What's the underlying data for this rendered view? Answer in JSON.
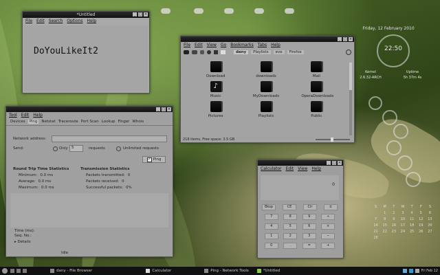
{
  "top_left_window": {
    "title": "*Untitled",
    "menu": [
      "File",
      "Edit",
      "Search",
      "Options",
      "Help"
    ],
    "content": "DoYouLikeIt2"
  },
  "file_browser": {
    "menu": [
      "File",
      "Edit",
      "View",
      "Go",
      "Bookmarks",
      "Tabs",
      "Help"
    ],
    "location_tabs": [
      "dany",
      "Playlists",
      "eve",
      "Firefox"
    ],
    "items": [
      "Download",
      "downloads",
      "Mail",
      "Music",
      "MyDownloads",
      "OperaDownloads",
      "Pictures",
      "Playlists",
      "Public"
    ],
    "status": "218 items, Free space: 3.5 GB"
  },
  "network_tools": {
    "menu": [
      "Tool",
      "Edit",
      "Help"
    ],
    "tabs": [
      "Devices",
      "Ping",
      "Netstat",
      "Traceroute",
      "Port Scan",
      "Lookup",
      "Finger",
      "Whois"
    ],
    "network_address_label": "Network address:",
    "send_label": "Send:",
    "only_label": "Only",
    "only_value": "5",
    "requests_label": "requests",
    "unlimited_label": "Unlimited requests",
    "ping_button": "Ping",
    "rtt_title": "Round Trip Time Statistics",
    "rtt": [
      {
        "label": "Minimum:",
        "value": "0.0 ms"
      },
      {
        "label": "Average:",
        "value": "0.0 ms"
      },
      {
        "label": "Maximum:",
        "value": "0.0 ms"
      }
    ],
    "trans_title": "Transmission Statistics",
    "trans": [
      {
        "label": "Packets transmitted:",
        "value": "0"
      },
      {
        "label": "Packets received:",
        "value": "0"
      },
      {
        "label": "Successful packets:",
        "value": "0%"
      }
    ],
    "time_label": "Time (ms):",
    "seq_label": "Seq. No.:",
    "details": "Details",
    "status": "Idle"
  },
  "calculator": {
    "menu": [
      "Calculator",
      "Edit",
      "View",
      "Help"
    ],
    "display": "0",
    "fn_buttons": [
      "Bksp",
      "CE",
      "Clr",
      "±"
    ],
    "keys": [
      "7",
      "8",
      "9",
      "÷",
      "4",
      "5",
      "6",
      "×",
      "1",
      "2",
      "3",
      "−",
      "0",
      ".",
      "=",
      "+"
    ]
  },
  "desktop_widgets": {
    "date": "Friday, 12 February 2010",
    "time": "22:50",
    "kernel_label": "Kernel",
    "kernel": "2.6.32-ARCH",
    "uptime_label": "Uptime",
    "uptime": "5h 37m 4s",
    "calendar_days": [
      "S",
      "M",
      "T",
      "W",
      "T",
      "F",
      "S"
    ],
    "calendar_rows": [
      [
        "",
        "1",
        "2",
        "3",
        "4",
        "5",
        "6"
      ],
      [
        "7",
        "8",
        "9",
        "10",
        "11",
        "12",
        "13"
      ],
      [
        "14",
        "15",
        "16",
        "17",
        "18",
        "19",
        "20"
      ],
      [
        "21",
        "22",
        "23",
        "24",
        "25",
        "26",
        "27"
      ],
      [
        "28",
        "",
        "",
        "",
        "",
        "",
        ""
      ]
    ]
  },
  "taskbar": {
    "tasks": [
      "dany - File Browser",
      "Calculator",
      "Ping - Network Tools",
      "*Untitled"
    ],
    "clock": "Fri Feb 12"
  }
}
